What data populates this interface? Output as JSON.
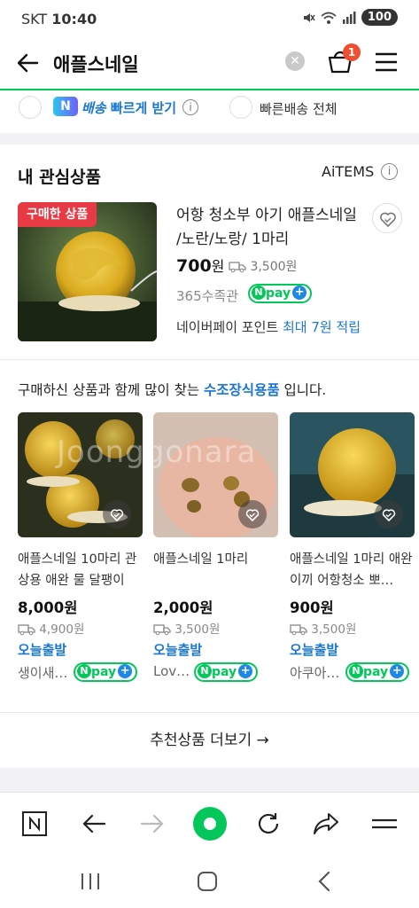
{
  "status_bar": {
    "carrier": "SKT",
    "time": "10:40",
    "battery": "100"
  },
  "header": {
    "query": "애플스네일",
    "cart_count": "1"
  },
  "filters": {
    "fast_badge": "N",
    "fast_word1": "배송",
    "fast_word2": "빠르게 받기",
    "all_fast": "빠른배송 전체"
  },
  "interest": {
    "title": "내 관심상품",
    "aitems": "AiTEMS",
    "badge": "구매한 상품",
    "product_title": "어항 청소부 아기 애플스네일 /노란/노랑/ 1마리",
    "price": "700",
    "price_unit": "원",
    "shipping": "3,500원",
    "store": "365수족관",
    "point_prefix": "네이버페이 포인트",
    "point_highlight": "최대 7원 적립"
  },
  "recommend": {
    "title_prefix": "구매하신 상품과 함께 많이 찾는",
    "title_highlight": "수조장식용품",
    "title_suffix": "입니다.",
    "watermark": "Joonggonara",
    "cards": [
      {
        "name": "애플스네일 10마리 관상용 애완 물 달팽이",
        "price": "8,000원",
        "shipping": "4,900원",
        "today": "오늘출발",
        "seller": "생이새…"
      },
      {
        "name": "애플스네일 1마리",
        "price": "2,000원",
        "shipping": "3,500원",
        "today": "오늘출발",
        "seller": "Lov…"
      },
      {
        "name": "애플스네일 1마리 애완 이끼 어항청소 뽀…",
        "price": "900원",
        "shipping": "3,500원",
        "today": "오늘출발",
        "seller": "아쿠아…"
      }
    ],
    "more_label": "추천상품 더보기 →"
  },
  "npay": {
    "n": "N",
    "label": "pay",
    "plus": "+"
  },
  "colors": {
    "naver_green": "#03c75a",
    "link_blue": "#1976d2",
    "badge_red": "#e73a44"
  }
}
